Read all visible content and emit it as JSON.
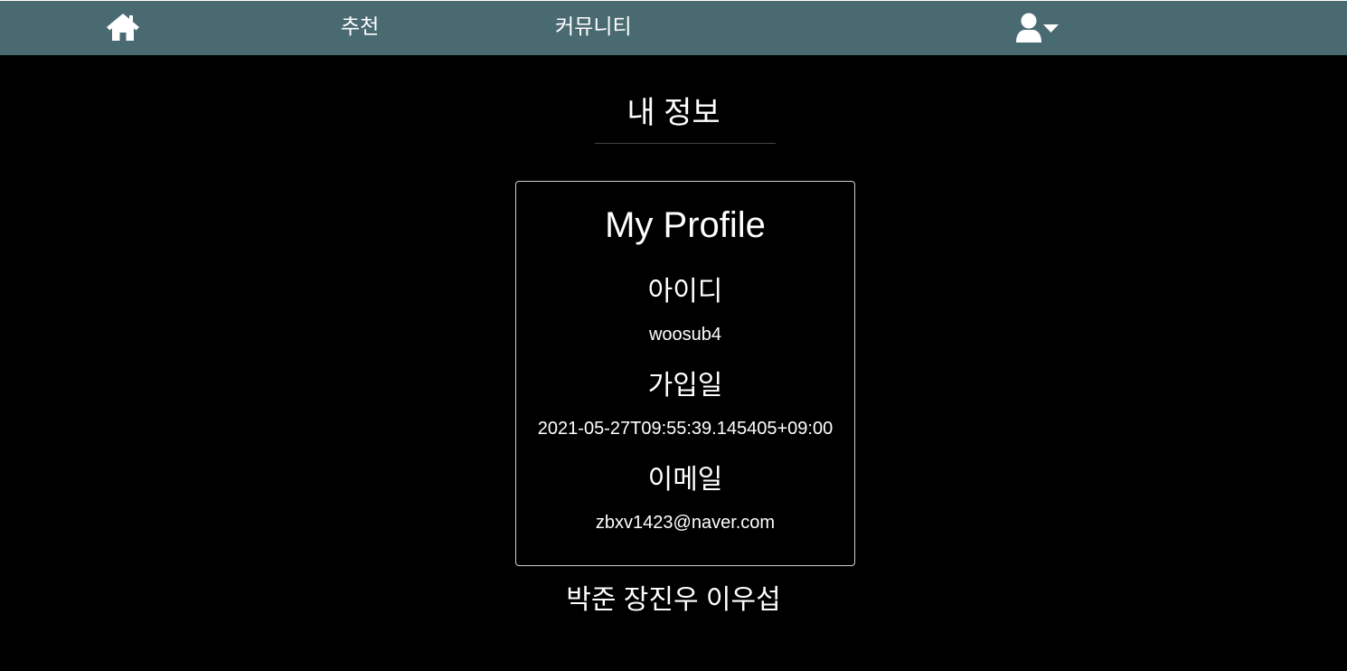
{
  "nav": {
    "home_icon": "home-icon",
    "recommend_label": "추천",
    "community_label": "커뮤니티",
    "user_icon": "user-dropdown-icon",
    "bar_color": "#4a6a72"
  },
  "page": {
    "title": "내 정보"
  },
  "profile": {
    "card_title": "My Profile",
    "id_label": "아이디",
    "id_value": "woosub4",
    "joined_label": "가입일",
    "joined_value": "2021-05-27T09:55:39.145405+09:00",
    "email_label": "이메일",
    "email_value": "zbxv1423@naver.com"
  },
  "footer": {
    "credits": "박준 장진우 이우섭"
  }
}
